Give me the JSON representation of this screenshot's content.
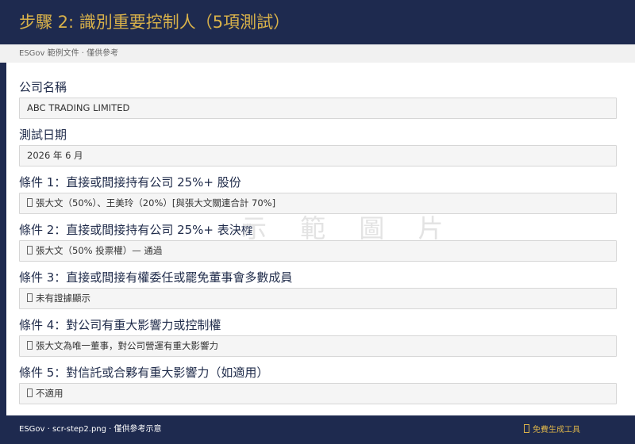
{
  "header": {
    "title": "步驟 2: 識別重要控制人（5項測試）"
  },
  "subbar": {
    "text": "ESGov 範例文件 · 僅供參考"
  },
  "watermark": "示 範 圖 片",
  "form": {
    "company": {
      "label": "公司名稱",
      "value": "ABC TRADING LIMITED"
    },
    "date": {
      "label": "測試日期",
      "value": "2026 年 6 月"
    },
    "tests": [
      {
        "label": "條件 1：直接或間接持有公司 25%+ 股份",
        "value": "張大文（50%）、王美玲（20%）[與張大文關連合計 70%]",
        "status_icon": "check-icon"
      },
      {
        "label": "條件 2：直接或間接持有公司 25%+ 表決權",
        "value": "張大文（50% 投票權）— 通過",
        "status_icon": "check-icon"
      },
      {
        "label": "條件 3：直接或間接有權委任或罷免董事會多數成員",
        "value": "未有證據顯示",
        "status_icon": "cross-icon"
      },
      {
        "label": "條件 4：對公司有重大影響力或控制權",
        "value": "張大文為唯一董事，對公司營運有重大影響力",
        "status_icon": "check-icon"
      },
      {
        "label": "條件 5：對信託或合夥有重大影響力（如適用）",
        "value": "不適用",
        "status_icon": "na-icon"
      }
    ]
  },
  "footer": {
    "left": "ESGov · scr-step2.png · 僅供參考示意",
    "cta": "免費生成工具"
  }
}
